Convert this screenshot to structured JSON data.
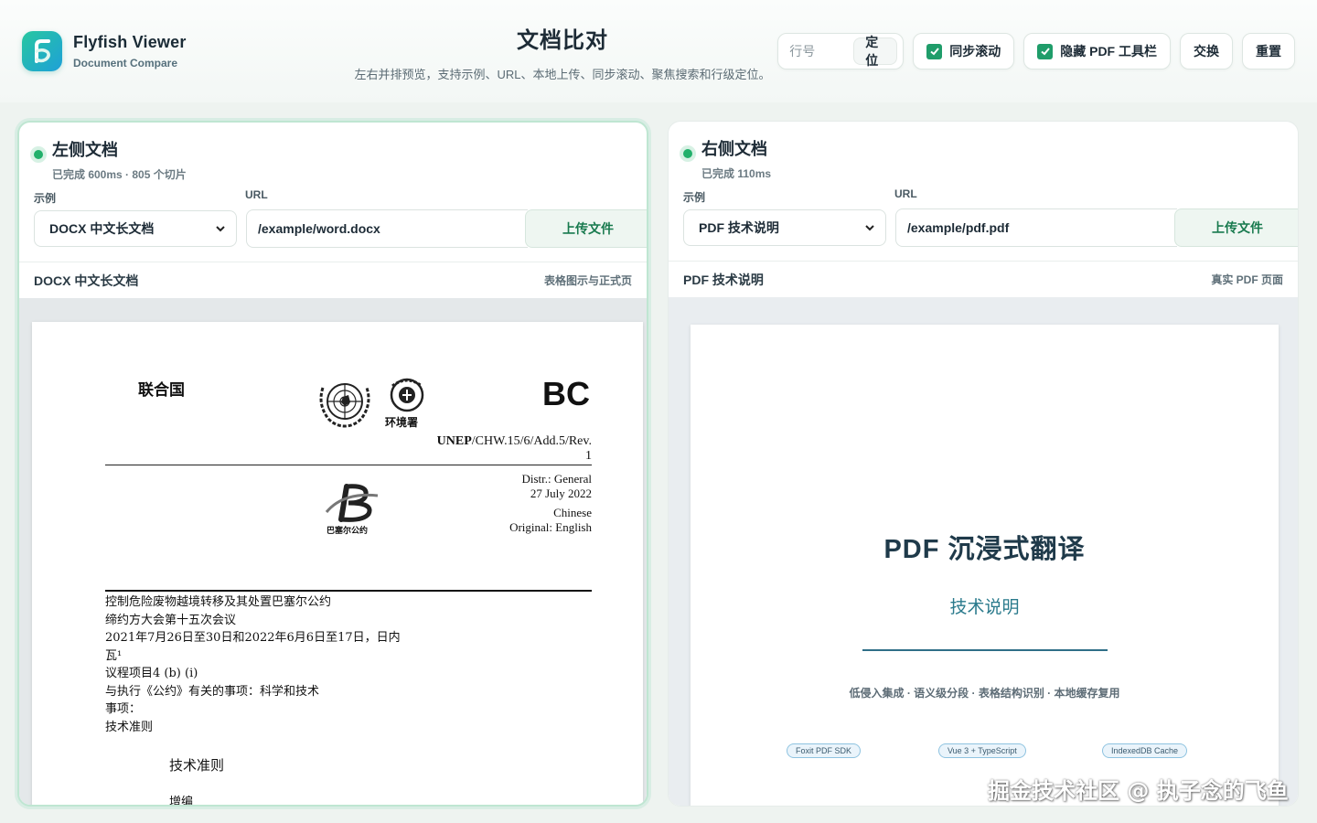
{
  "brand": {
    "name": "Flyfish Viewer",
    "subtitle": "Document Compare"
  },
  "header": {
    "title": "文档比对",
    "subtitle": "左右并排预览，支持示例、URL、本地上传、同步滚动、聚焦搜索和行级定位。"
  },
  "toolbar": {
    "line_placeholder": "行号",
    "locate_label": "定位",
    "sync_scroll_label": "同步滚动",
    "sync_scroll_checked": true,
    "hide_pdf_toolbar_label": "隐藏 PDF 工具栏",
    "hide_pdf_toolbar_checked": true,
    "swap_label": "交换",
    "reset_label": "重置"
  },
  "left": {
    "title": "左侧文档",
    "status": "已完成 600ms · 805 个切片",
    "example_label": "示例",
    "example_value": "DOCX 中文长文档",
    "url_label": "URL",
    "url_value": "/example/word.docx",
    "upload_label": "上传文件",
    "doc_title": "DOCX 中文长文档",
    "doc_tag": "表格图示与正式页",
    "page": {
      "org": "联合国",
      "env_label": "环境署",
      "code": "BC",
      "symbol_bold": "UNEP",
      "symbol_rest": "/CHW.15/6/Add.5/Rev.",
      "symbol_line2": "1",
      "basel_label": "巴塞尔公约",
      "distr": "Distr.: General",
      "date": "27 July 2022",
      "language": "Chinese",
      "original": "Original: English",
      "lines": [
        "控制危险废物越境转移及其处置巴塞尔公约",
        "缔约方大会第十五次会议",
        "2021年7月26日至30日和2022年6月6日至17日，日内",
        "瓦¹",
        "议程项目4 (b) (i)",
        "与执行《公约》有关的事项：科学和技术",
        "事项：",
        "技术准则"
      ],
      "heading": "技术准则",
      "subheading": "增编"
    }
  },
  "right": {
    "title": "右侧文档",
    "status": "已完成 110ms",
    "example_label": "示例",
    "example_value": "PDF 技术说明",
    "url_label": "URL",
    "url_value": "/example/pdf.pdf",
    "upload_label": "上传文件",
    "doc_title": "PDF 技术说明",
    "doc_tag": "真实 PDF 页面",
    "page": {
      "title": "PDF 沉浸式翻译",
      "subtitle": "技术说明",
      "features": "低侵入集成 · 语义级分段 · 表格结构识别 · 本地缓存复用",
      "tags": [
        "Foxit PDF SDK",
        "Vue 3 + TypeScript",
        "IndexedDB Cache"
      ]
    }
  },
  "watermark": "掘金技术社区 @ 执子念的飞鱼",
  "colors": {
    "accent": "#1f9d6a",
    "status_dot": "#22b06b",
    "upload_text": "#187a4e",
    "pdf_title": "#1f3a4a",
    "pdf_subtitle": "#2a7a8c"
  }
}
